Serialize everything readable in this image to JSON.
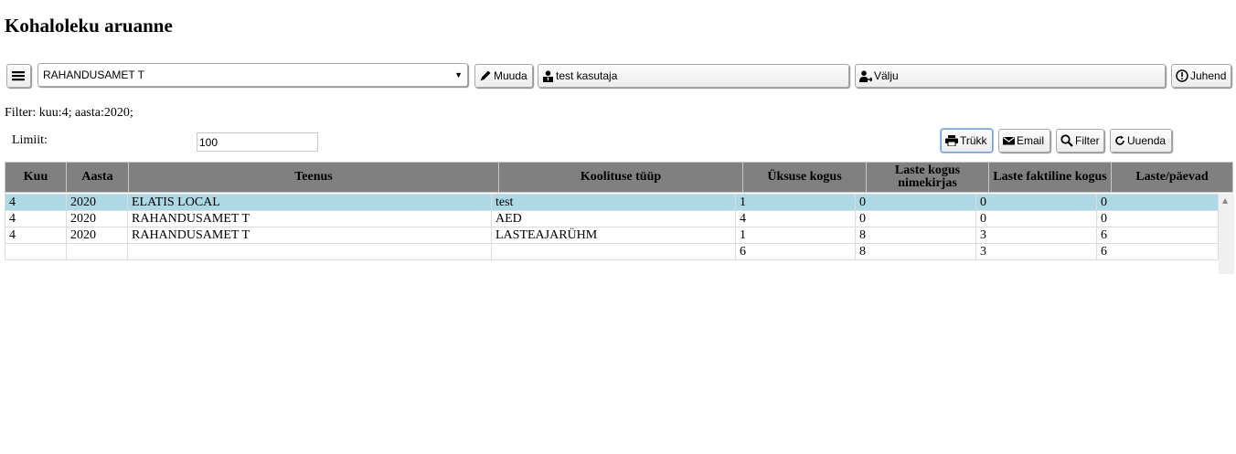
{
  "page_title": "Kohaloleku aruanne",
  "toolbar": {
    "menu_icon": "hamburger-icon",
    "institution_value": "RAHANDUSAMET T",
    "edit_label": "Muuda",
    "user_label": "test kasutaja",
    "logout_label": "Välju",
    "help_label": "Juhend"
  },
  "filter_text": "Filter: kuu:4; aasta:2020;",
  "limit": {
    "label": "Limiit:",
    "value": "100"
  },
  "actions": {
    "print_label": "Trükk",
    "email_label": "Email",
    "filter_label": "Filter",
    "refresh_label": "Uuenda"
  },
  "table": {
    "columns": [
      "Kuu",
      "Aasta",
      "Teenus",
      "Koolituse tüüp",
      "Üksuse kogus",
      "Laste kogus nimekirjas",
      "Laste faktiline kogus",
      "Laste/päevad"
    ],
    "rows": [
      [
        "4",
        "2020",
        "ELATIS LOCAL",
        "test",
        "1",
        "0",
        "0",
        "0"
      ],
      [
        "4",
        "2020",
        "RAHANDUSAMET T",
        "AED",
        "4",
        "0",
        "0",
        "0"
      ],
      [
        "4",
        "2020",
        "RAHANDUSAMET T",
        "LASTEAJARÜHM",
        "1",
        "8",
        "3",
        "6"
      ],
      [
        "",
        "",
        "",
        "",
        "6",
        "8",
        "3",
        "6"
      ]
    ],
    "selected_row": 0
  },
  "colors": {
    "header_bg": "#808080",
    "selected_row_bg": "#add8e6"
  }
}
